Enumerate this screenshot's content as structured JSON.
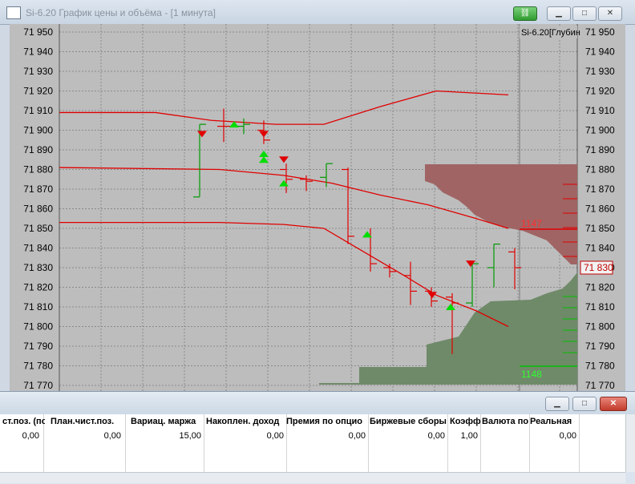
{
  "window": {
    "title": "Si-6.20 График цены и объёма - [1 минута]"
  },
  "chart": {
    "corner_label": "Si-6.20[Глубин",
    "y_ticks": [
      "71 950",
      "71 940",
      "71 930",
      "71 920",
      "71 910",
      "71 900",
      "71 890",
      "71 880",
      "71 870",
      "71 860",
      "71 850",
      "71 840",
      "71 830",
      "71 820",
      "71 810",
      "71 800",
      "71 790",
      "71 780",
      "71 770"
    ],
    "current_price_label": "71 830",
    "ask_volume_label": "1147",
    "bid_volume_label": "1148",
    "colors": {
      "background": "#bdbdbd",
      "grid": "#8a8a8a",
      "red": "#e00000",
      "green": "#009900",
      "ask_area": "#a06464",
      "bid_area": "#6f8a69"
    }
  },
  "chart_data": {
    "type": "line",
    "ylim": [
      71770,
      71950
    ],
    "series": [
      {
        "values": [
          [
            0,
            71909
          ],
          [
            120,
            71909
          ],
          [
            190,
            71905
          ],
          [
            270,
            71903
          ],
          [
            330,
            71903
          ],
          [
            400,
            71912
          ],
          [
            470,
            71920
          ],
          [
            560,
            71918
          ]
        ]
      },
      {
        "values": [
          [
            0,
            71881
          ],
          [
            200,
            71880
          ],
          [
            280,
            71877
          ],
          [
            340,
            71873
          ],
          [
            400,
            71867
          ],
          [
            460,
            71862
          ],
          [
            520,
            71855
          ],
          [
            560,
            71850
          ]
        ]
      },
      {
        "values": [
          [
            0,
            71853
          ],
          [
            200,
            71853
          ],
          [
            280,
            71852
          ],
          [
            330,
            71850
          ],
          [
            380,
            71838
          ],
          [
            430,
            71826
          ],
          [
            470,
            71816
          ],
          [
            520,
            71808
          ],
          [
            560,
            71800
          ]
        ]
      }
    ],
    "bars": [
      {
        "x": 175,
        "high": 71903,
        "low": 71866,
        "open": 71866,
        "close": 71903,
        "color": "green"
      },
      {
        "x": 205,
        "high": 71911,
        "low": 71894,
        "open": 71902,
        "close": 71902,
        "color": "red"
      },
      {
        "x": 230,
        "high": 71906,
        "low": 71898,
        "open": 71902,
        "close": 71903,
        "color": "green"
      },
      {
        "x": 255,
        "high": 71905,
        "low": 71893,
        "open": 71900,
        "close": 71895,
        "color": "red"
      },
      {
        "x": 283,
        "high": 71883,
        "low": 71868,
        "open": 71880,
        "close": 71875,
        "color": "red"
      },
      {
        "x": 308,
        "high": 71877,
        "low": 71869,
        "open": 71875,
        "close": 71874,
        "color": "red"
      },
      {
        "x": 333,
        "high": 71883,
        "low": 71871,
        "open": 71876,
        "close": 71883,
        "color": "green"
      },
      {
        "x": 360,
        "high": 71881,
        "low": 71842,
        "open": 71880,
        "close": 71846,
        "color": "red"
      },
      {
        "x": 388,
        "high": 71850,
        "low": 71828,
        "open": 71846,
        "close": 71832,
        "color": "red"
      },
      {
        "x": 412,
        "high": 71832,
        "low": 71825,
        "open": 71830,
        "close": 71828,
        "color": "red"
      },
      {
        "x": 438,
        "high": 71833,
        "low": 71811,
        "open": 71826,
        "close": 71818,
        "color": "red"
      },
      {
        "x": 464,
        "high": 71820,
        "low": 71810,
        "open": 71818,
        "close": 71813,
        "color": "red"
      },
      {
        "x": 490,
        "high": 71817,
        "low": 71786,
        "open": 71815,
        "close": 71812,
        "color": "red"
      },
      {
        "x": 515,
        "high": 71832,
        "low": 71810,
        "open": 71812,
        "close": 71832,
        "color": "green"
      },
      {
        "x": 542,
        "high": 71842,
        "low": 71820,
        "open": 71830,
        "close": 71842,
        "color": "green"
      },
      {
        "x": 568,
        "high": 71840,
        "low": 71819,
        "open": 71838,
        "close": 71830,
        "color": "red"
      }
    ],
    "markers": [
      {
        "x": 178,
        "y": 71898,
        "dir": "down"
      },
      {
        "x": 218,
        "y": 71903,
        "dir": "up"
      },
      {
        "x": 255,
        "y": 71898,
        "dir": "down"
      },
      {
        "x": 255,
        "y": 71888,
        "dir": "up"
      },
      {
        "x": 255,
        "y": 71885,
        "dir": "up"
      },
      {
        "x": 280,
        "y": 71885,
        "dir": "down"
      },
      {
        "x": 280,
        "y": 71873,
        "dir": "up"
      },
      {
        "x": 384,
        "y": 71847,
        "dir": "up"
      },
      {
        "x": 465,
        "y": 71816,
        "dir": "down"
      },
      {
        "x": 488,
        "y": 71810,
        "dir": "up"
      },
      {
        "x": 513,
        "y": 71832,
        "dir": "down"
      }
    ]
  },
  "subwindow": {
    "headers": [
      "ст.поз. (по",
      "План.чист.поз.",
      "Вариац. маржа",
      "Накоплен. доход",
      "Премия по опцио",
      "Биржевые сборы",
      "Коэфф.",
      "Валюта по",
      "Реальная"
    ],
    "values": [
      "0,00",
      "0,00",
      "15,00",
      "0,00",
      "0,00",
      "0,00",
      "1,00",
      "",
      "0,00"
    ]
  }
}
